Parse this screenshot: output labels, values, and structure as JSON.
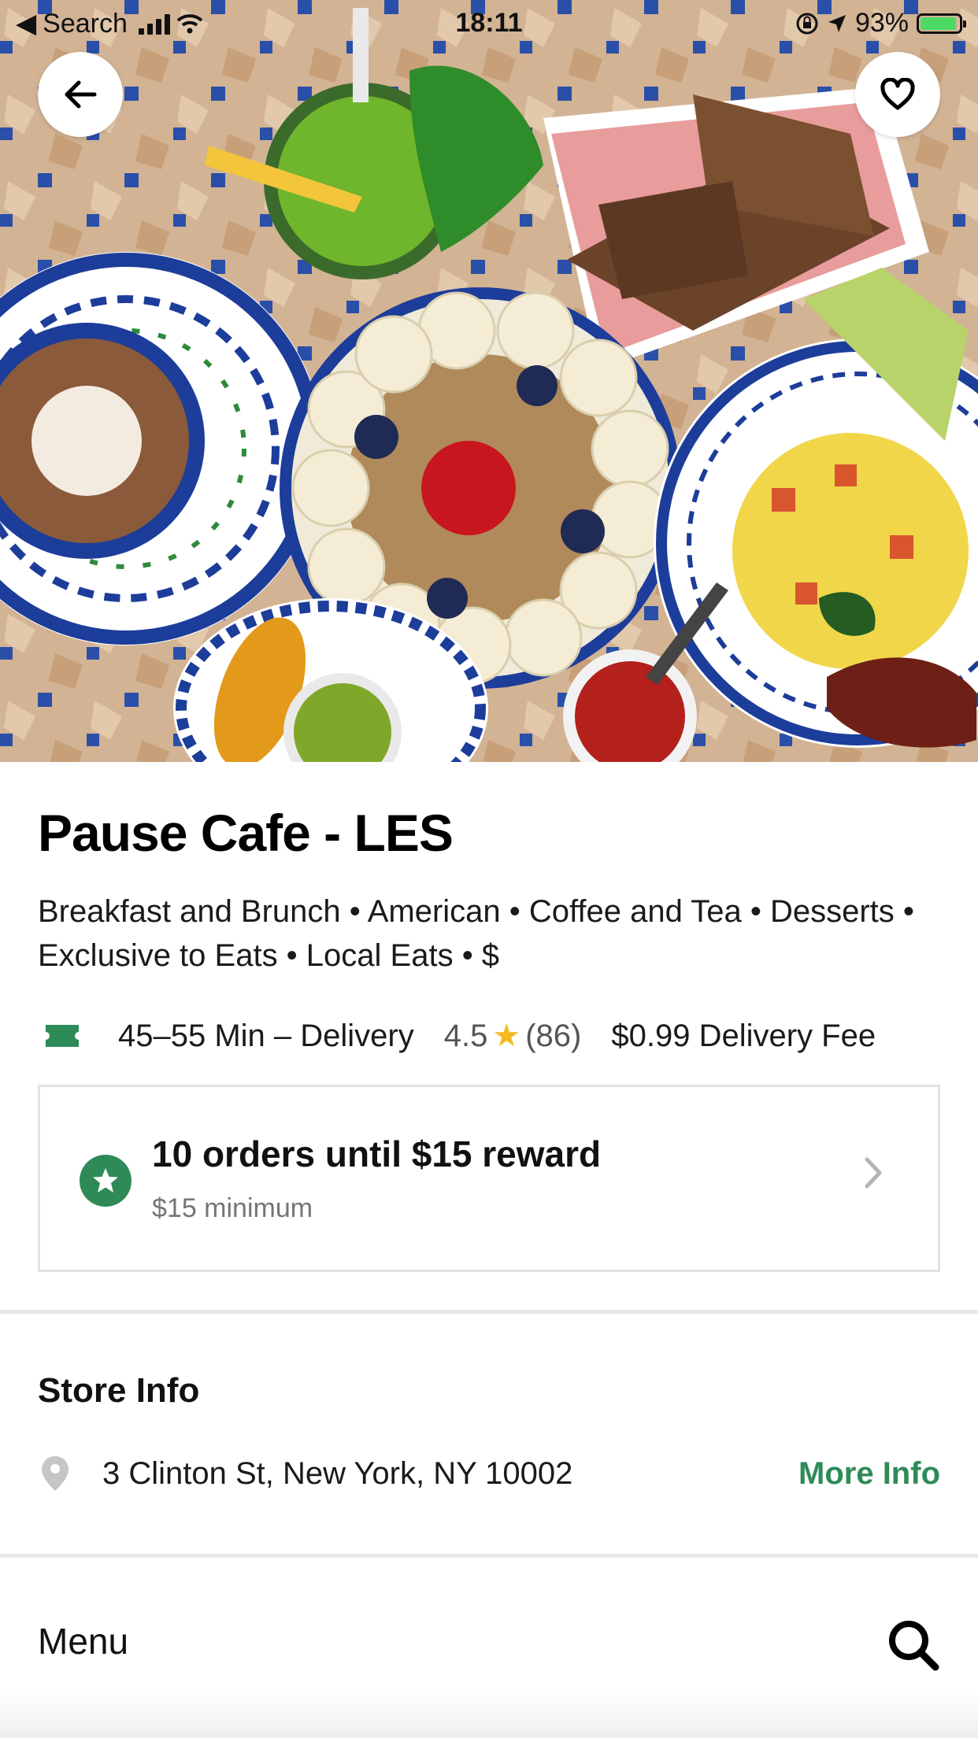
{
  "status_bar": {
    "back_app": "Search",
    "time": "18:11",
    "battery": "93%",
    "battery_level": 0.93
  },
  "hero": {
    "back_icon": "arrow-left-icon",
    "favorite_icon": "heart-outline-icon"
  },
  "store": {
    "name": "Pause Cafe - LES",
    "categories": "Breakfast and Brunch • American • Coffee and Tea • Desserts • Exclusive to Eats • Local Eats • $",
    "delivery_time": "45–55 Min – Delivery",
    "rating": "4.5",
    "review_count": "(86)",
    "delivery_fee": "$0.99 Delivery Fee"
  },
  "reward": {
    "title": "10 orders until $15 reward",
    "subtitle": "$15 minimum",
    "icon": "star-badge-icon"
  },
  "store_info": {
    "heading": "Store Info",
    "address": "3 Clinton St, New York, NY 10002",
    "more_info_label": "More Info"
  },
  "menu": {
    "label": "Menu",
    "search_icon": "search-icon"
  },
  "colors": {
    "brand_green": "#2e8b57",
    "star_yellow": "#f5b922",
    "divider": "#e8e8e8"
  }
}
